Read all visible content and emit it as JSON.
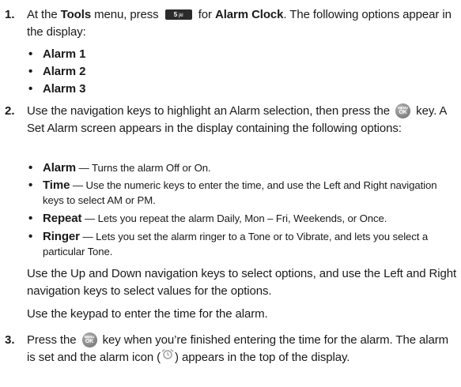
{
  "steps": [
    {
      "number": "1.",
      "text_a": "At the ",
      "tools": "Tools",
      "text_b": " menu, press ",
      "key_label": "5",
      "key_letters": "jkl",
      "text_c": " for ",
      "alarm_clock": "Alarm Clock",
      "text_d": ". The following options appear in the display:",
      "options": [
        "Alarm 1",
        "Alarm 2",
        "Alarm 3"
      ]
    },
    {
      "number": "2.",
      "text_a": "Use the navigation keys to highlight an Alarm selection, then press the",
      "text_b": "key. A Set Alarm screen appears in the display containing the following options:",
      "bullets": [
        {
          "term": "Alarm",
          "desc": " — Turns the alarm Off or On."
        },
        {
          "term": "Time",
          "desc": " — Use the numeric keys to enter the time, and use the Left and Right navigation keys to select AM or PM."
        },
        {
          "term": "Repeat",
          "desc": " — Lets you repeat the alarm Daily, Mon – Fri, Weekends, or Once."
        },
        {
          "term": "Ringer",
          "desc": " — Lets you set the alarm ringer to a Tone or to Vibrate, and lets you select a particular Tone."
        }
      ],
      "note_1": "Use the Up and Down navigation keys to select options, and use the Left and Right navigation keys to select values for the options.",
      "note_2": "Use the keypad to enter the time for the alarm."
    },
    {
      "number": "3.",
      "text_a": "Press the",
      "text_b": "key when you’re finished entering the time for the alarm. The alarm is set and the alarm icon (",
      "text_c": ") appears in the top of the display."
    }
  ],
  "ok_key": {
    "top": "MENU",
    "bottom": "OK"
  },
  "icons": [
    "menu-ok-key-icon",
    "alarm-clock-icon",
    "number-5-key-icon"
  ]
}
